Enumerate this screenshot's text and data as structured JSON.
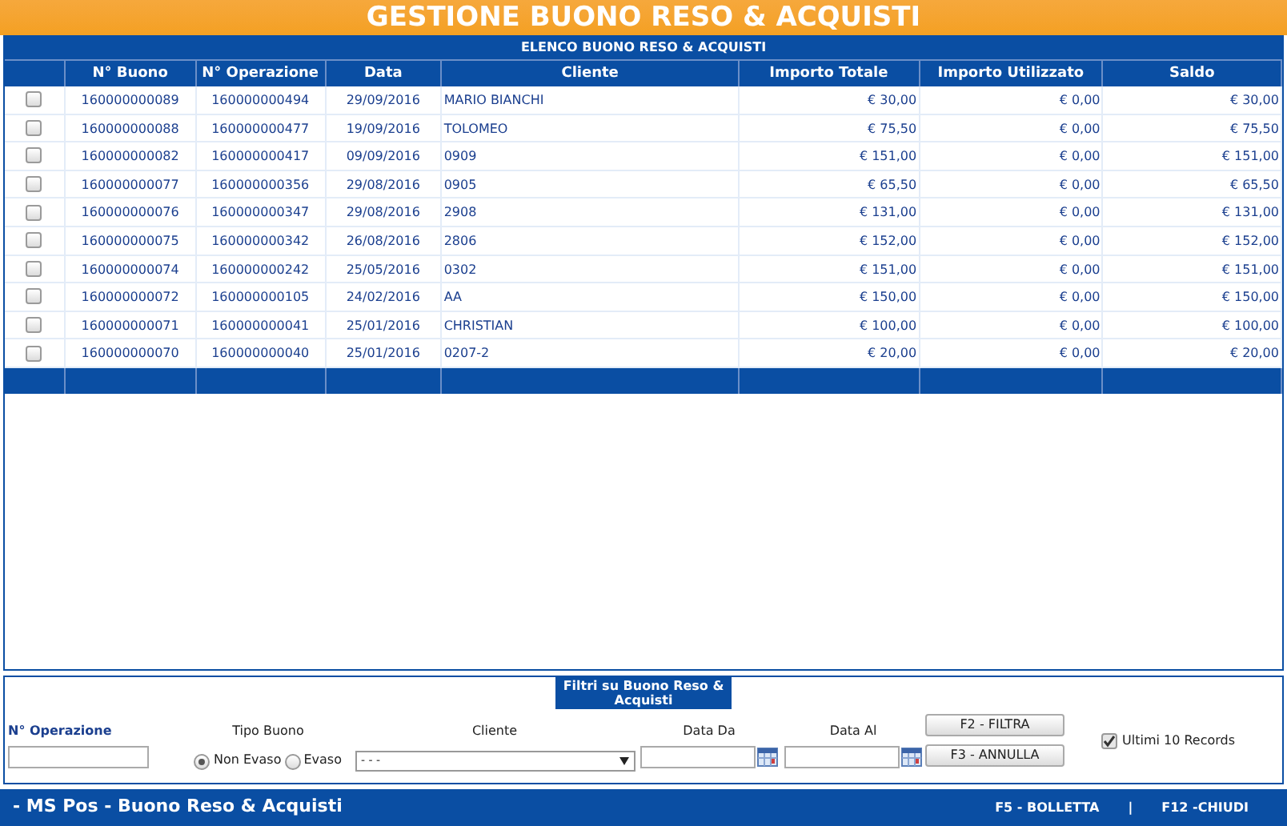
{
  "title": "GESTIONE BUONO RESO & ACQUISTI",
  "list_title": "ELENCO BUONO RESO & ACQUISTI",
  "table": {
    "columns": [
      "N° Buono",
      "N° Operazione",
      "Data",
      "Cliente",
      "Importo Totale",
      "Importo Utilizzato",
      "Saldo"
    ],
    "rows": [
      {
        "checked": false,
        "cells": [
          "160000000089",
          "160000000494",
          "29/09/2016",
          "MARIO BIANCHI",
          "€ 30,00",
          "€ 0,00",
          "€ 30,00"
        ]
      },
      {
        "checked": false,
        "cells": [
          "160000000088",
          "160000000477",
          "19/09/2016",
          "TOLOMEO",
          "€ 75,50",
          "€ 0,00",
          "€ 75,50"
        ]
      },
      {
        "checked": false,
        "cells": [
          "160000000082",
          "160000000417",
          "09/09/2016",
          "0909",
          "€ 151,00",
          "€ 0,00",
          "€ 151,00"
        ]
      },
      {
        "checked": false,
        "cells": [
          "160000000077",
          "160000000356",
          "29/08/2016",
          "0905",
          "€ 65,50",
          "€ 0,00",
          "€ 65,50"
        ]
      },
      {
        "checked": false,
        "cells": [
          "160000000076",
          "160000000347",
          "29/08/2016",
          "2908",
          "€ 131,00",
          "€ 0,00",
          "€ 131,00"
        ]
      },
      {
        "checked": false,
        "cells": [
          "160000000075",
          "160000000342",
          "26/08/2016",
          "2806",
          "€ 152,00",
          "€ 0,00",
          "€ 152,00"
        ]
      },
      {
        "checked": false,
        "cells": [
          "160000000074",
          "160000000242",
          "25/05/2016",
          "0302",
          "€ 151,00",
          "€ 0,00",
          "€ 151,00"
        ]
      },
      {
        "checked": false,
        "cells": [
          "160000000072",
          "160000000105",
          "24/02/2016",
          "AA",
          "€ 150,00",
          "€ 0,00",
          "€ 150,00"
        ]
      },
      {
        "checked": false,
        "cells": [
          "160000000071",
          "160000000041",
          "25/01/2016",
          "CHRISTIAN",
          "€ 100,00",
          "€ 0,00",
          "€ 100,00"
        ]
      },
      {
        "checked": false,
        "cells": [
          "160000000070",
          "160000000040",
          "25/01/2016",
          "0207-2",
          "€ 20,00",
          "€ 0,00",
          "€ 20,00"
        ]
      }
    ]
  },
  "filters": {
    "title": "Filtri su Buono Reso & Acquisti",
    "operazione_label": "N° Operazione",
    "tipo_label": "Tipo Buono",
    "tipo_options": [
      {
        "label": "Non Evaso",
        "selected": true
      },
      {
        "label": "Evaso",
        "selected": false
      }
    ],
    "cliente_label": "Cliente",
    "cliente_value": "- - -",
    "data_da_label": "Data Da",
    "data_al_label": "Data Al",
    "buttons": [
      "F2 - FILTRA",
      "F3 - ANNULLA"
    ],
    "ultimi": {
      "label": "Ultimi 10 Records",
      "checked": true
    }
  },
  "footer": {
    "title": "- MS Pos - Buono Reso & Acquisti",
    "actions": [
      "F5 - BOLLETTA",
      "|",
      "F12 -CHIUDI"
    ]
  }
}
